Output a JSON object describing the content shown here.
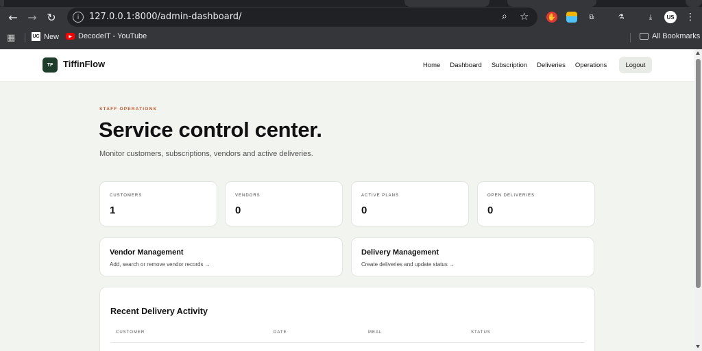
{
  "browser": {
    "url": "127.0.0.1:8000/admin-dashboard/",
    "avatar_label": "US",
    "bookmarks": [
      {
        "label": "New"
      },
      {
        "label": "DecodeIT - YouTube"
      }
    ],
    "all_bookmarks_label": "All Bookmarks"
  },
  "header": {
    "logo_badge": "TF",
    "brand": "TiffinFlow",
    "nav": [
      "Home",
      "Dashboard",
      "Subscription",
      "Deliveries",
      "Operations"
    ],
    "logout_label": "Logout"
  },
  "hero": {
    "eyebrow": "STAFF OPERATIONS",
    "title": "Service control center.",
    "subtitle": "Monitor customers, subscriptions, vendors and active deliveries."
  },
  "stats": [
    {
      "label": "CUSTOMERS",
      "value": "1"
    },
    {
      "label": "VENDORS",
      "value": "0"
    },
    {
      "label": "ACTIVE PLANS",
      "value": "0"
    },
    {
      "label": "OPEN DELIVERIES",
      "value": "0"
    }
  ],
  "links": [
    {
      "title": "Vendor Management",
      "desc": "Add, search or remove vendor records →"
    },
    {
      "title": "Delivery Management",
      "desc": "Create deliveries and update status →"
    }
  ],
  "activity": {
    "title": "Recent Delivery Activity",
    "columns": [
      "CUSTOMER",
      "DATE",
      "MEAL",
      "STATUS"
    ]
  },
  "colors": {
    "accent": "#c2562c",
    "brand_dark": "#1f3d2b",
    "page_bg": "#f2f4ef"
  }
}
